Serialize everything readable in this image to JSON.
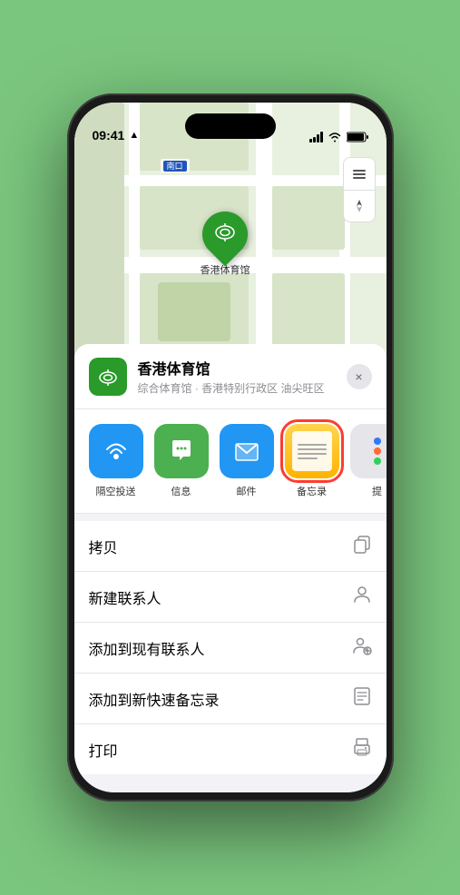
{
  "status_bar": {
    "time": "09:41",
    "location_arrow": "▲"
  },
  "map": {
    "label_text": "南口",
    "pin_label": "香港体育馆"
  },
  "map_buttons": {
    "layers_icon": "🗺",
    "location_icon": "➤"
  },
  "venue": {
    "name": "香港体育馆",
    "description": "综合体育馆 · 香港特别行政区 油尖旺区",
    "close_label": "×"
  },
  "share_items": [
    {
      "id": "airdrop",
      "label": "隔空投送",
      "icon": "📡"
    },
    {
      "id": "messages",
      "label": "信息",
      "icon": "💬"
    },
    {
      "id": "mail",
      "label": "邮件",
      "icon": "✉️"
    },
    {
      "id": "notes",
      "label": "备忘录",
      "icon": "notes",
      "selected": true
    },
    {
      "id": "more",
      "label": "提",
      "icon": "more"
    }
  ],
  "actions": [
    {
      "id": "copy",
      "label": "拷贝",
      "icon": "copy"
    },
    {
      "id": "new-contact",
      "label": "新建联系人",
      "icon": "person"
    },
    {
      "id": "add-contact",
      "label": "添加到现有联系人",
      "icon": "person-add"
    },
    {
      "id": "add-note",
      "label": "添加到新快速备忘录",
      "icon": "note"
    },
    {
      "id": "print",
      "label": "打印",
      "icon": "print"
    }
  ]
}
